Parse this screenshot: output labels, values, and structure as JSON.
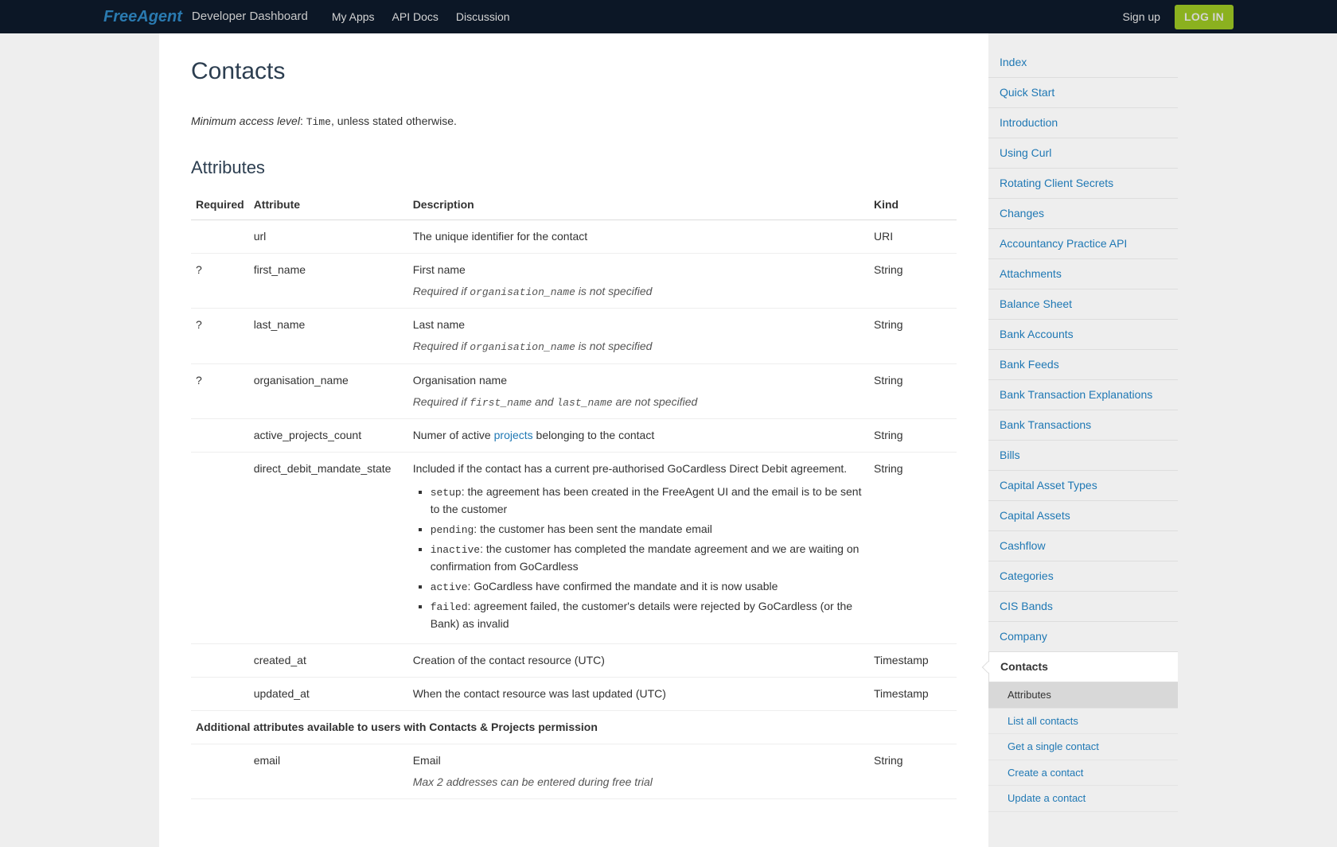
{
  "topbar": {
    "logo_main": "FreeAgent",
    "logo_sub": "Developer Dashboard",
    "nav": [
      "My Apps",
      "API Docs",
      "Discussion"
    ],
    "signup": "Sign up",
    "login": "LOG IN"
  },
  "page": {
    "title": "Contacts",
    "access_label": "Minimum access level",
    "access_value": "Time",
    "access_suffix": ", unless stated otherwise.",
    "attributes_heading": "Attributes",
    "table_headers": {
      "required": "Required",
      "attribute": "Attribute",
      "description": "Description",
      "kind": "Kind"
    },
    "section_additional": "Additional attributes available to users with Contacts & Projects permission",
    "rows": {
      "url": {
        "req": "",
        "attr": "url",
        "desc": "The unique identifier for the contact",
        "kind": "URI"
      },
      "first_name": {
        "req": "?",
        "attr": "first_name",
        "desc": "First name",
        "note_pre": "Required if ",
        "note_code": "organisation_name",
        "note_post": " is not specified",
        "kind": "String"
      },
      "last_name": {
        "req": "?",
        "attr": "last_name",
        "desc": "Last name",
        "note_pre": "Required if ",
        "note_code": "organisation_name",
        "note_post": " is not specified",
        "kind": "String"
      },
      "org": {
        "req": "?",
        "attr": "organisation_name",
        "desc": "Organisation name",
        "note_pre": "Required if ",
        "note_code1": "first_name",
        "note_mid": " and ",
        "note_code2": "last_name",
        "note_post": " are not specified",
        "kind": "String"
      },
      "apc": {
        "req": "",
        "attr": "active_projects_count",
        "desc_pre": "Numer of active ",
        "desc_link": "projects",
        "desc_post": " belonging to the contact",
        "kind": "String"
      },
      "ddms": {
        "req": "",
        "attr": "direct_debit_mandate_state",
        "desc": "Included if the contact has a current pre-authorised GoCardless Direct Debit agreement.",
        "kind": "String",
        "states": [
          {
            "code": "setup",
            "text": ": the agreement has been created in the FreeAgent UI and the email is to be sent to the customer"
          },
          {
            "code": "pending",
            "text": ": the customer has been sent the mandate email"
          },
          {
            "code": "inactive",
            "text": ": the customer has completed the mandate agreement and we are waiting on confirmation from GoCardless"
          },
          {
            "code": "active",
            "text": ": GoCardless have confirmed the mandate and it is now usable"
          },
          {
            "code": "failed",
            "text": ": agreement failed, the customer's details were rejected by GoCardless (or the Bank) as invalid"
          }
        ]
      },
      "created": {
        "req": "",
        "attr": "created_at",
        "desc": "Creation of the contact resource (UTC)",
        "kind": "Timestamp"
      },
      "updated": {
        "req": "",
        "attr": "updated_at",
        "desc": "When the contact resource was last updated (UTC)",
        "kind": "Timestamp"
      },
      "email": {
        "req": "",
        "attr": "email",
        "desc": "Email",
        "note": "Max 2 addresses can be entered during free trial",
        "kind": "String"
      }
    }
  },
  "sidebar": {
    "items": [
      "Index",
      "Quick Start",
      "Introduction",
      "Using Curl",
      "Rotating Client Secrets",
      "Changes",
      "Accountancy Practice API",
      "Attachments",
      "Balance Sheet",
      "Bank Accounts",
      "Bank Feeds",
      "Bank Transaction Explanations",
      "Bank Transactions",
      "Bills",
      "Capital Asset Types",
      "Capital Assets",
      "Cashflow",
      "Categories",
      "CIS Bands",
      "Company"
    ],
    "active": "Contacts",
    "subs": [
      "Attributes",
      "List all contacts",
      "Get a single contact",
      "Create a contact",
      "Update a contact"
    ]
  }
}
